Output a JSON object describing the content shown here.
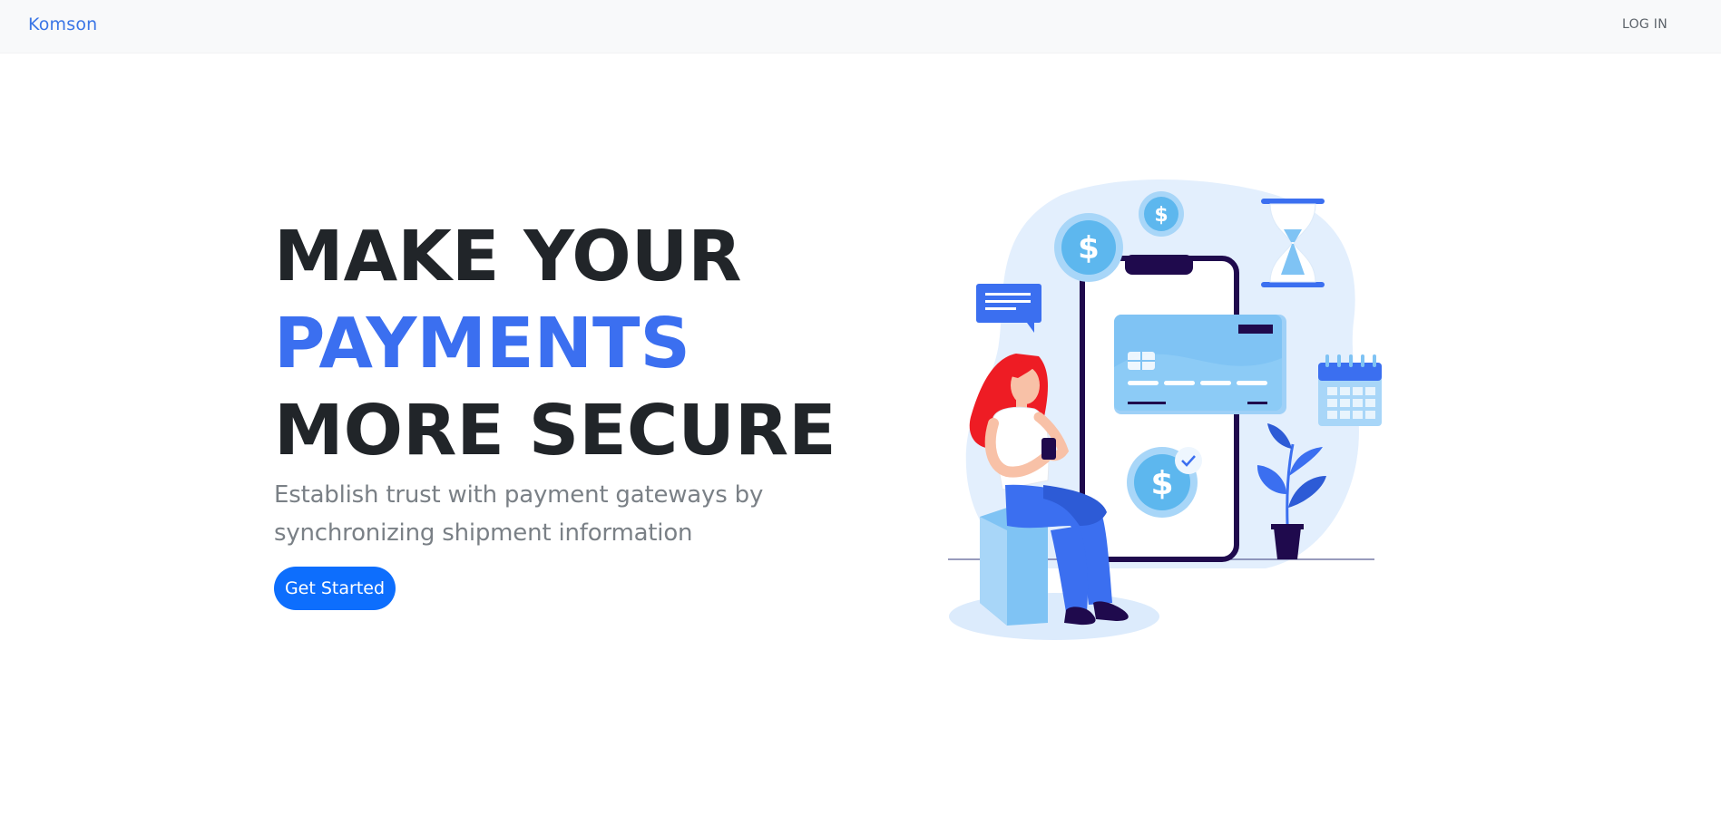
{
  "navbar": {
    "brand": "Komson",
    "login_label": "LOG IN"
  },
  "hero": {
    "title_line_1": "MAKE YOUR",
    "title_line_2": "PAYMENTS",
    "title_line_3": "MORE SECURE",
    "subtitle": "Establish trust with payment gateways by synchronizing shipment information",
    "cta_label": "Get Started"
  },
  "illustration": {
    "icons": [
      "dollar-coin-icon",
      "chat-bubble-icon",
      "credit-card-icon",
      "hourglass-icon",
      "calendar-icon",
      "plant-icon",
      "check-icon",
      "smartphone-icon"
    ],
    "coin_symbol": "$"
  },
  "colors": {
    "brand": "#3a75e6",
    "accent": "#3b6ff0",
    "button": "#0d6efd",
    "heading": "#212529",
    "subtitle": "#7a8086"
  }
}
